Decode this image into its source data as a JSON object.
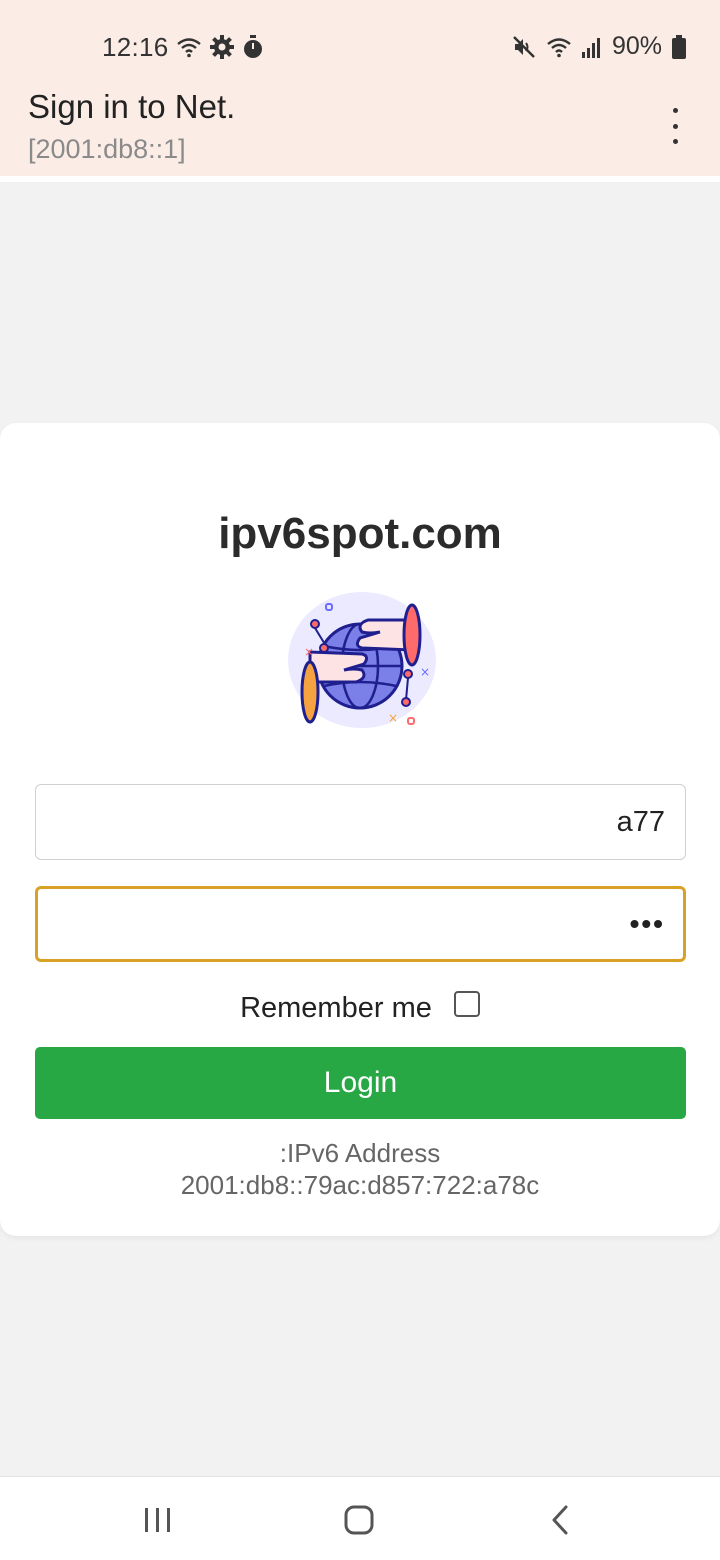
{
  "status_bar": {
    "time": "12:16",
    "battery": "90%",
    "icons": [
      "wifi-icon",
      "settings-icon",
      "timer-icon",
      "mute-icon",
      "wifi-signal-icon",
      "cell-signal-icon",
      "battery-icon"
    ]
  },
  "app_bar": {
    "title": "Sign in to Net.",
    "subtitle": "[2001:db8::1]",
    "menu_icon": "more-vert-icon"
  },
  "login_card": {
    "site_title": "ipv6spot.com",
    "illustration": "globe-hands-illustration",
    "username_value": "a77",
    "password_value": "•••",
    "remember_label": "Remember me",
    "remember_checked": false,
    "login_label": "Login",
    "ipv6_label": ":IPv6 Address",
    "ipv6_value": "2001:db8::79ac:d857:722:a78c"
  },
  "colors": {
    "header_bg": "#fbede5",
    "login_button": "#28a745",
    "focus_border": "#d9a225"
  },
  "nav_bar": {
    "buttons": [
      "recent-apps-icon",
      "home-icon",
      "back-icon"
    ]
  }
}
